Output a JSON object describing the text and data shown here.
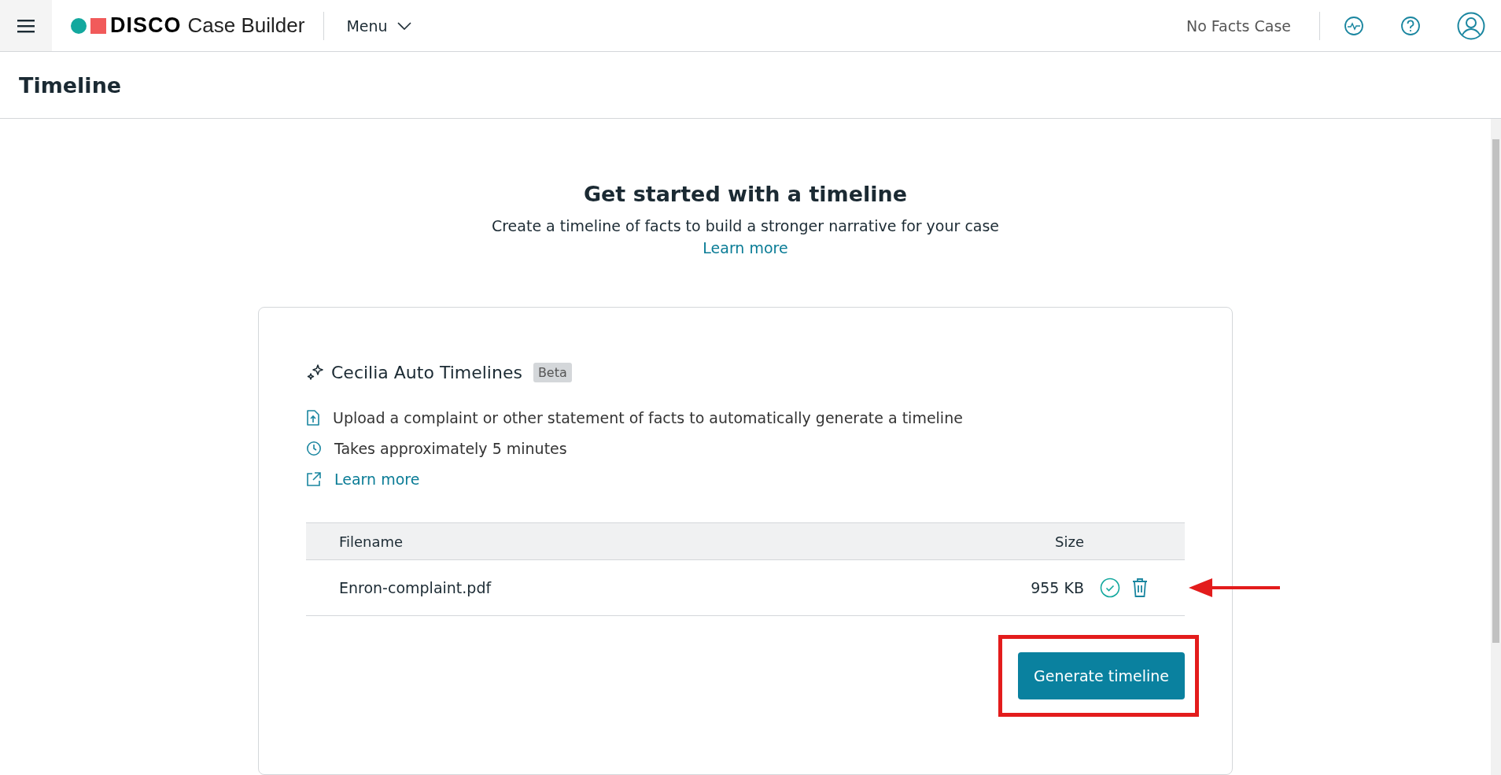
{
  "header": {
    "brand": "DISCO",
    "product": "Case Builder",
    "menu": "Menu",
    "case_name": "No Facts Case"
  },
  "page_title": "Timeline",
  "intro": {
    "heading": "Get started with a timeline",
    "text": "Create a timeline of facts to build a stronger narrative for your case",
    "link": "Learn more"
  },
  "card": {
    "title": "Cecilia Auto Timelines",
    "badge": "Beta",
    "items": [
      {
        "kind": "upload",
        "text": "Upload a complaint or other statement of facts to automatically generate a timeline"
      },
      {
        "kind": "clock",
        "text": "Takes approximately 5 minutes"
      },
      {
        "kind": "link",
        "text": "Learn more"
      }
    ],
    "table": {
      "columns": [
        "Filename",
        "Size"
      ],
      "rows": [
        {
          "filename": "Enron-complaint.pdf",
          "size": "955 KB"
        }
      ]
    },
    "button": "Generate timeline"
  }
}
